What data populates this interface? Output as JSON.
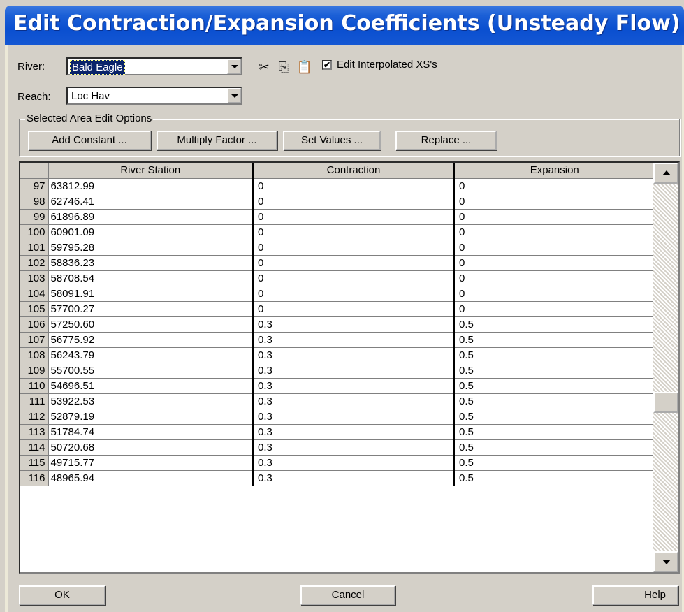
{
  "window": {
    "title": "Edit Contraction/Expansion Coefficients (Unsteady Flow)"
  },
  "river": {
    "label": "River:",
    "value": "Bald Eagle"
  },
  "reach": {
    "label": "Reach:",
    "value": "Loc Hav"
  },
  "toolbar": {
    "edit_interpolated_label": "Edit Interpolated XS's",
    "edit_interpolated_checked": true,
    "check_mark": "✔"
  },
  "edit_options": {
    "group_label": "Selected Area Edit Options",
    "add_constant": "Add Constant ...",
    "multiply_factor": "Multiply Factor ...",
    "set_values": "Set Values ...",
    "replace": "Replace ..."
  },
  "table": {
    "headers": [
      "",
      "River Station",
      "Contraction",
      "Expansion"
    ],
    "rows": [
      [
        "97",
        "63812.99",
        "0",
        "0"
      ],
      [
        "98",
        "62746.41",
        "0",
        "0"
      ],
      [
        "99",
        "61896.89",
        "0",
        "0"
      ],
      [
        "100",
        "60901.09",
        "0",
        "0"
      ],
      [
        "101",
        "59795.28",
        "0",
        "0"
      ],
      [
        "102",
        "58836.23",
        "0",
        "0"
      ],
      [
        "103",
        "58708.54",
        "0",
        "0"
      ],
      [
        "104",
        "58091.91",
        "0",
        "0"
      ],
      [
        "105",
        "57700.27",
        "0",
        "0"
      ],
      [
        "106",
        "57250.60",
        "0.3",
        "0.5"
      ],
      [
        "107",
        "56775.92",
        "0.3",
        "0.5"
      ],
      [
        "108",
        "56243.79",
        "0.3",
        "0.5"
      ],
      [
        "109",
        "55700.55",
        "0.3",
        "0.5"
      ],
      [
        "110",
        "54696.51",
        "0.3",
        "0.5"
      ],
      [
        "111",
        "53922.53",
        "0.3",
        "0.5"
      ],
      [
        "112",
        "52879.19",
        "0.3",
        "0.5"
      ],
      [
        "113",
        "51784.74",
        "0.3",
        "0.5"
      ],
      [
        "114",
        "50720.68",
        "0.3",
        "0.5"
      ],
      [
        "115",
        "49715.77",
        "0.3",
        "0.5"
      ],
      [
        "116",
        "48965.94",
        "0.3",
        "0.5"
      ]
    ]
  },
  "footer": {
    "ok": "OK",
    "cancel": "Cancel",
    "help": "Help"
  }
}
